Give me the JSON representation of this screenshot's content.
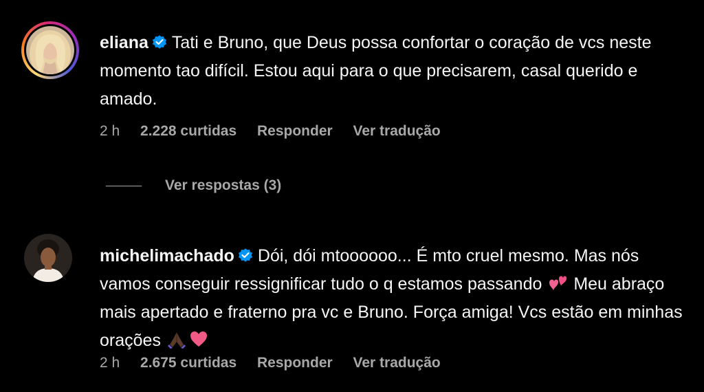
{
  "comments": [
    {
      "username": "eliana",
      "verified": true,
      "avatar_icon": "profile-photo-blonde-woman",
      "text": "Tati e Bruno, que Deus possa confortar o coração de vcs neste momento tao difícil. Estou aqui para o que precisarem, casal querido e amado.",
      "time": "2 h",
      "likes": "2.228 curtidas",
      "reply_label": "Responder",
      "translate_label": "Ver tradução",
      "view_replies_label": "Ver respostas (3)"
    },
    {
      "username": "michelimachado",
      "verified": true,
      "avatar_icon": "profile-photo-dark-hair-woman",
      "text_part1": "Dói, dói mtoooooo... É mto cruel mesmo. Mas nós vamos conseguir ressignificar tudo o q estamos passando",
      "text_part2": "Meu abraço mais apertado e fraterno pra vc e Bruno. Força amiga! Vcs estão em minhas orações",
      "emojis": [
        "two-hearts-emoji",
        "praying-hands-emoji",
        "pink-heart-emoji"
      ],
      "time": "2 h",
      "likes": "2.675 curtidas",
      "reply_label": "Responder",
      "translate_label": "Ver tradução"
    }
  ],
  "colors": {
    "background": "#000000",
    "text": "#f5f5f5",
    "secondary": "#a8a8a8",
    "verified": "#0095f6"
  }
}
